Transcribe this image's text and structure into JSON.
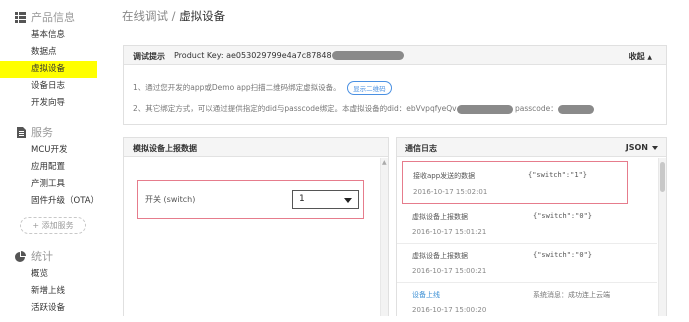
{
  "sidebar": {
    "sections": [
      {
        "title": "产品信息",
        "icon": "grid-icon",
        "items": [
          {
            "label": "基本信息"
          },
          {
            "label": "数据点"
          },
          {
            "label": "虚拟设备",
            "active": true
          },
          {
            "label": "设备日志"
          },
          {
            "label": "开发向导"
          }
        ]
      },
      {
        "title": "服务",
        "icon": "document-icon",
        "items": [
          {
            "label": "MCU开发"
          },
          {
            "label": "应用配置"
          },
          {
            "label": "产测工具"
          },
          {
            "label": "固件升级（OTA）"
          }
        ],
        "add_button": "+ 添加服务"
      },
      {
        "title": "统计",
        "icon": "pie-chart-icon",
        "items": [
          {
            "label": "概览"
          },
          {
            "label": "新增上线"
          },
          {
            "label": "活跃设备"
          }
        ]
      }
    ],
    "active_color": "#ffff00"
  },
  "breadcrumb": {
    "parent": "在线调试",
    "separator": "/",
    "current": "虚拟设备"
  },
  "tip_panel": {
    "title": "调试提示",
    "product_key_label": "Product Key:",
    "product_key_value": "ae053029799e4a7c87848",
    "collapse_label": "收起",
    "line1_text": "1、通过您开发的app或Demo app扫描二维码绑定虚拟设备。",
    "qr_button": "显示二维码",
    "line2_text": "2、其它绑定方式，可以通过提供指定的did与passcode绑定。本虚拟设备的did：ebVvpqfyeQv",
    "passcode_label": "passcode："
  },
  "report_panel": {
    "title": "模拟设备上报数据",
    "switch_label": "开关 (switch)",
    "switch_value": "1"
  },
  "log_panel": {
    "title": "通信日志",
    "format": "JSON",
    "entries": [
      {
        "title": "接收app发送的数据",
        "value": "{\"switch\":\"1\"}",
        "time": "2016-10-17 15:02:01",
        "highlight": true
      },
      {
        "title": "虚拟设备上报数据",
        "value": "{\"switch\":\"0\"}",
        "time": "2016-10-17 15:01:21"
      },
      {
        "title": "虚拟设备上报数据",
        "value": "{\"switch\":\"0\"}",
        "time": "2016-10-17 15:00:21"
      },
      {
        "title": "设备上线",
        "value": "系统消息：成功连上云端",
        "time": "2016-10-17 15:00:20",
        "title_color": "#3b8fd4"
      }
    ]
  },
  "colors": {
    "highlight_border": "#e67c8c",
    "link_blue": "#3b8fd4"
  }
}
